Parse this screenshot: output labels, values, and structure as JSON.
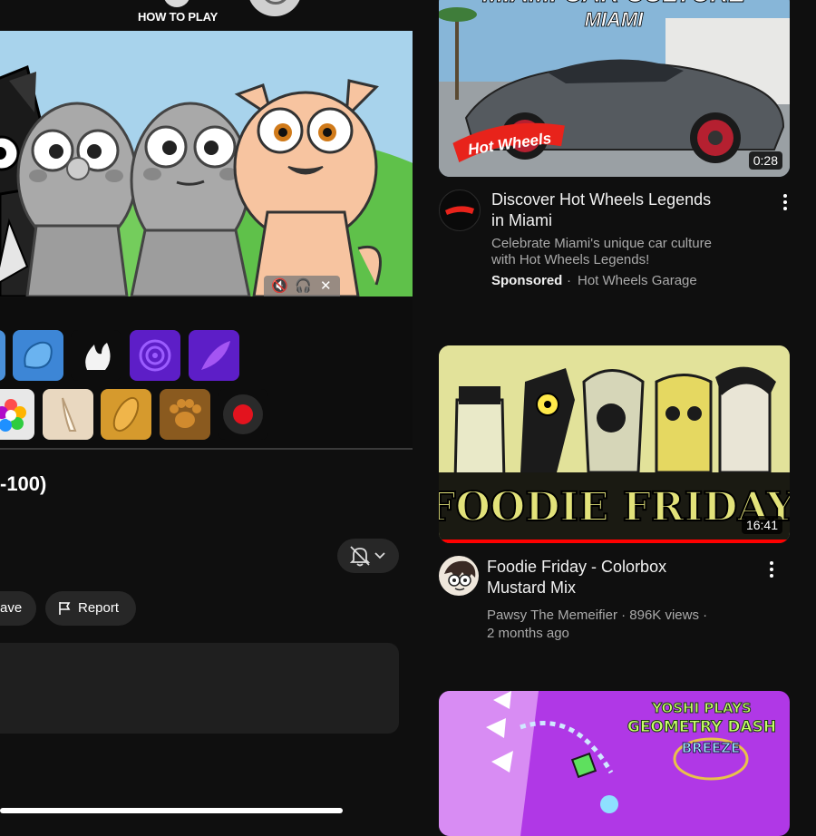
{
  "game": {
    "how_to_play_label": "HOW TO PLAY",
    "audio_controls": {
      "mute_icon": "speaker-mute-icon",
      "headphones_icon": "headphones-icon",
      "close_icon": "close-icon"
    },
    "sound_tiles_row1": [
      "blue-blob-icon",
      "white-flame-icon",
      "purple-spiral-icon",
      "purple-feather-icon"
    ],
    "sound_tiles_row2": [
      "flower-icon",
      "horn-icon",
      "bread-icon",
      "paw-icon",
      "record-icon"
    ]
  },
  "video": {
    "title_fragment": "-100)",
    "save_label": "ave",
    "report_label": "Report"
  },
  "colors": {
    "background": "#0f0f0f",
    "chip": "#272727",
    "meta_text": "#aaaaaa",
    "record_red": "#e3131e"
  },
  "feed": {
    "items": [
      {
        "thumb_text_line1": "MIAMI CAR CULTURE",
        "thumb_text_line2": "MIAMI",
        "thumb_logo": "Hot Wheels",
        "duration": "0:28",
        "title_line1": "Discover Hot Wheels Legends",
        "title_line2": "in Miami",
        "desc_line1": "Celebrate Miami's unique car culture",
        "desc_line2": "with Hot Wheels Legends!",
        "sponsored": "Sponsored",
        "separator": "·",
        "channel": "Hot Wheels Garage"
      },
      {
        "thumb_text": "FOODIE FRIDAY",
        "duration": "16:41",
        "title_line1": "Foodie Friday - Colorbox",
        "title_line2": "Mustard Mix",
        "meta_line1": "Pawsy The Memeifier · 896K views ·",
        "meta_line2": "2 months ago"
      },
      {
        "thumb_text_line1": "YOSHI PLAYS",
        "thumb_text_line2": "GEOMETRY DASH",
        "thumb_text_line3": "BREEZE"
      }
    ]
  }
}
